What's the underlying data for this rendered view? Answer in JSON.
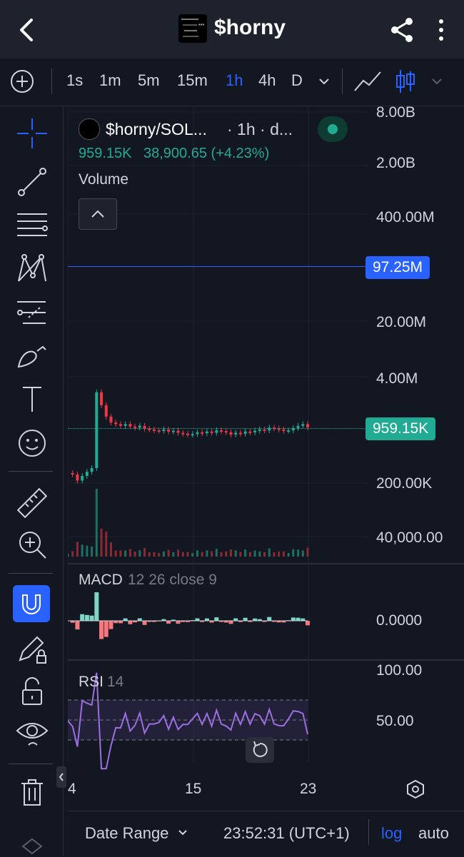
{
  "header": {
    "title": "$horny",
    "icons": {
      "back": "chevron-left-icon",
      "share": "share-icon",
      "more": "more-vertical-icon"
    }
  },
  "toolbar": {
    "timeframes": [
      "1s",
      "1m",
      "5m",
      "15m",
      "1h",
      "4h",
      "D"
    ],
    "active_timeframe": "1h",
    "icons": [
      "add-indicator-icon",
      "timeframe-dropdown-icon",
      "line-chart-icon",
      "candles-icon",
      "chart-type-dropdown-icon"
    ],
    "accent": "#2962ff"
  },
  "left_tools": [
    "crosshair-icon",
    "trend-line-icon",
    "fib-lines-icon",
    "pattern-icon",
    "forecast-icon",
    "brush-icon",
    "text-icon",
    "emoji-icon",
    "ruler-icon",
    "zoom-in-icon",
    "magnet-icon",
    "pencil-lock-icon",
    "lock-icon",
    "eye-icon",
    "trash-icon"
  ],
  "legend": {
    "symbol": "$horny/SOL...",
    "interval": "· 1h · d...",
    "price": "959.15K",
    "change": "38,900.65 (+4.23%)",
    "volume_label": "Volume",
    "status_color": "#089981"
  },
  "price_scale": {
    "labels": [
      "8.00B",
      "2.00B",
      "400.00M",
      "20.00M",
      "4.00M",
      "200.00K",
      "40,000.00"
    ],
    "horizontal_line_value": "97.25M",
    "horizontal_line_color": "#2962ff",
    "last_price": "959.15K",
    "last_price_color": "#089981"
  },
  "macd": {
    "name": "MACD",
    "params": "12 26 close 9",
    "scale_label": "0.0000"
  },
  "rsi": {
    "name": "RSI",
    "params": "14",
    "scale_labels": [
      "100.00",
      "50.00"
    ],
    "band_color": "#7e57c2"
  },
  "time_axis": {
    "labels": [
      "4",
      "15",
      "23"
    ]
  },
  "bottom": {
    "date_range": "Date Range",
    "clock": "23:52:31 (UTC+1)",
    "log": "log",
    "auto": "auto"
  },
  "chart_data": {
    "type": "line",
    "series": [
      {
        "name": "$horny/SOL",
        "x": [
          0,
          2,
          4,
          6,
          8,
          10,
          12,
          14,
          16,
          18,
          20,
          22,
          24,
          26,
          28,
          30,
          32,
          34,
          36,
          38,
          40,
          42,
          44,
          46,
          48,
          50,
          52,
          54,
          56,
          58,
          60,
          62,
          64,
          66,
          68,
          70,
          72,
          74,
          76,
          78,
          80,
          82,
          84,
          86,
          88,
          90,
          92,
          94,
          96,
          98,
          100
        ],
        "y": [
          260000,
          250000,
          210000,
          240000,
          270000,
          300000,
          2600000,
          1800000,
          1300000,
          1100000,
          1050000,
          1000000,
          1050000,
          980000,
          950000,
          1000000,
          920000,
          900000,
          880000,
          870000,
          900000,
          850000,
          870000,
          820000,
          800000,
          780000,
          790000,
          830000,
          810000,
          850000,
          820000,
          880000,
          860000,
          830000,
          780000,
          820000,
          800000,
          850000,
          830000,
          870000,
          900000,
          880000,
          950000,
          930000,
          900000,
          870000,
          880000,
          940000,
          1000000,
          1050000,
          959150
        ]
      }
    ],
    "x_tick_labels": [
      "4",
      "15",
      "23"
    ],
    "y_tick_labels": [
      "8.00B",
      "2.00B",
      "400.00M",
      "20.00M",
      "4.00M",
      "200.00K",
      "40,000.00"
    ],
    "log_scale": true
  }
}
